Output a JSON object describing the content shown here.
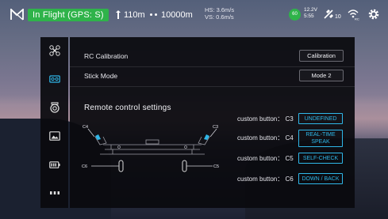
{
  "topbar": {
    "flight_status": "In Flight (GPS: S)",
    "altitude": "110m",
    "distance": "10000m",
    "hs": "HS: 3.6m/s",
    "vs": "VS: 0.6m/s",
    "battery_percent": "60",
    "voltage": "12.2V",
    "flight_time": "5:55",
    "satellites": "10",
    "rc_signal_label": "RC"
  },
  "sidebar": {
    "items": [
      {
        "name": "aircraft",
        "icon": "drone-icon"
      },
      {
        "name": "remote-controller",
        "icon": "remote-controller-icon"
      },
      {
        "name": "gimbal",
        "icon": "camera-icon"
      },
      {
        "name": "image-transmission",
        "icon": "image-icon"
      },
      {
        "name": "battery",
        "icon": "battery-icon"
      },
      {
        "name": "more",
        "icon": "more-icon"
      }
    ],
    "active_index": 1
  },
  "settings": {
    "rc_calibration_label": "RC Calibration",
    "rc_calibration_button": "Calibration",
    "stick_mode_label": "Stick Mode",
    "stick_mode_value": "Mode 2",
    "section_title": "Remote control settings",
    "custom_buttons": [
      {
        "label": "custom button： C3",
        "value": "UNDEFINED"
      },
      {
        "label": "custom button： C4",
        "value": "REAL-TIME SPEAK"
      },
      {
        "label": "custom button： C5",
        "value": "SELF-CHECK"
      },
      {
        "label": "custom button： C6",
        "value": "DOWN / BACK"
      }
    ],
    "diagram_labels": {
      "c3": "C3",
      "c4": "C4",
      "c5": "C5",
      "c6": "C6"
    }
  },
  "colors": {
    "accent": "#2fb7e8",
    "flight_ok": "#2fb34a",
    "panel": "#0a0a0e"
  }
}
